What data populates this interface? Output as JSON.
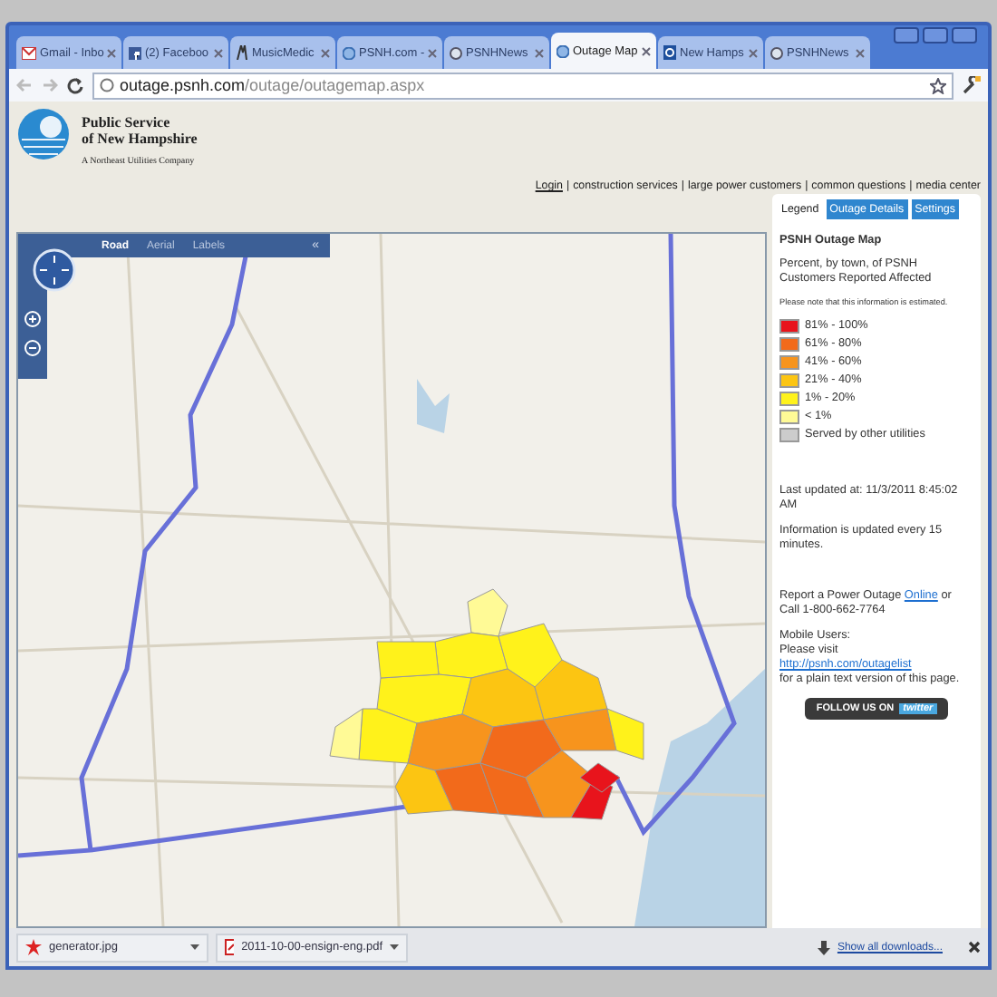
{
  "browser_tabs": [
    {
      "label": "Gmail - Inbo",
      "selected": false,
      "kind": "mail"
    },
    {
      "label": "(2) Faceboo",
      "selected": false,
      "kind": "social"
    },
    {
      "label": "MusicMedic",
      "selected": false,
      "kind": "music"
    },
    {
      "label": "PSNH.com -",
      "selected": false,
      "kind": "globe"
    },
    {
      "label": "PSNHNews",
      "selected": false,
      "kind": "feed"
    },
    {
      "label": "Outage Map",
      "selected": true,
      "kind": "globe"
    },
    {
      "label": "New Hamps",
      "selected": false,
      "kind": "letter"
    },
    {
      "label": "PSNHNews",
      "selected": false,
      "kind": "feed"
    }
  ],
  "address": {
    "host": "outage.psnh.com",
    "path": "/outage/outagemap.aspx"
  },
  "logo": {
    "line_1": "Public Service",
    "line_2": "of New Hampshire",
    "tagline": "A Northeast Utilities Company"
  },
  "nav_links": [
    {
      "label": "Login",
      "underlined": true
    },
    {
      "label": "construction services",
      "underlined": false
    },
    {
      "label": "large power customers",
      "underlined": false
    },
    {
      "label": "common questions",
      "underlined": false
    },
    {
      "label": "media center",
      "underlined": false
    }
  ],
  "nav_separator": "|",
  "map": {
    "modes": [
      {
        "label": "Road",
        "selected": true
      },
      {
        "label": "Aerial",
        "selected": false
      },
      {
        "label": "Labels",
        "selected": false
      }
    ],
    "collapse": "«"
  },
  "panel_tabs": [
    {
      "label": "Legend",
      "selected": true
    },
    {
      "label": "Outage Details",
      "selected": false
    },
    {
      "label": "Settings",
      "selected": false
    }
  ],
  "legend": {
    "title": "PSNH Outage Map",
    "subtitle": "Percent, by town, of PSNH Customers Reported Affected",
    "note": "Please note that this information is estimated.",
    "items": [
      {
        "label": "81% - 100%",
        "color": "#e8141c"
      },
      {
        "label": "61% - 80%",
        "color": "#f26a1b"
      },
      {
        "label": "41% - 60%",
        "color": "#f7941d"
      },
      {
        "label": "21% - 40%",
        "color": "#fcc512"
      },
      {
        "label": "1% - 20%",
        "color": "#fff21b"
      },
      {
        "label": "< 1%",
        "color": "#fffa96"
      },
      {
        "label": "Served by other utilities",
        "color": "#cccccc"
      }
    ]
  },
  "last_updated": "Last updated at: 11/3/2011 8:45:02 AM",
  "update_note": "Information is updated every 15 minutes.",
  "report": {
    "before": "Report a Power Outage",
    "link": "Online",
    "after": "or Call 1-800-662-7764"
  },
  "mobile": {
    "heading": "Mobile Users:",
    "before": "Please visit",
    "link": "http://psnh.com/outagelist",
    "after": "for a plain text version of this page."
  },
  "follow_button": {
    "label": "FOLLOW US ON",
    "brand": "twitter"
  },
  "downloads": [
    {
      "name": "generator.jpg",
      "kind": "image"
    },
    {
      "name": "2011-10-00-ensign-eng.pdf",
      "kind": "pdf"
    }
  ],
  "show_all": "Show all downloads..."
}
